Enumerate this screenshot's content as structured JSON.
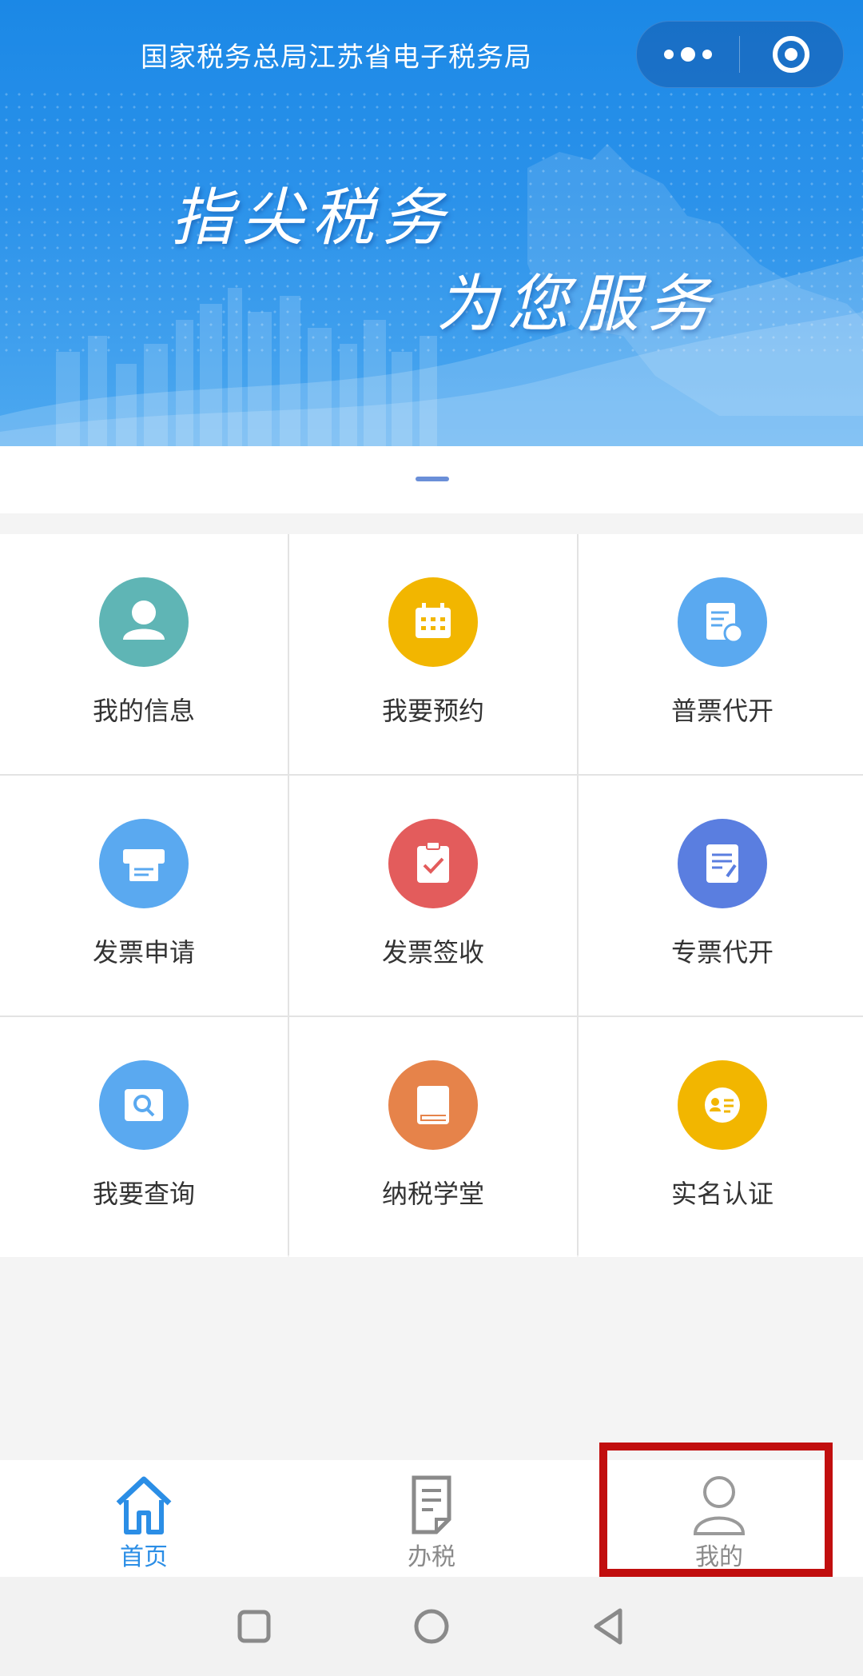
{
  "header": {
    "title": "国家税务总局江苏省电子税务局",
    "slogan_line1": "指尖税务",
    "slogan_line2": "为您服务"
  },
  "colors": {
    "header_blue": "#1b88e6",
    "accent_blue": "#2b8ee6",
    "highlight_red": "#c10e0e"
  },
  "grid": {
    "items": [
      {
        "label": "我的信息",
        "icon": "user-icon",
        "color": "#5fb5b5"
      },
      {
        "label": "我要预约",
        "icon": "calendar-icon",
        "color": "#f2b600"
      },
      {
        "label": "普票代开",
        "icon": "receipt-icon",
        "color": "#5aa9f0"
      },
      {
        "label": "发票申请",
        "icon": "printer-icon",
        "color": "#5aa9f0"
      },
      {
        "label": "发票签收",
        "icon": "clipboard-check-icon",
        "color": "#e35c5c"
      },
      {
        "label": "专票代开",
        "icon": "document-edit-icon",
        "color": "#5a7ee0"
      },
      {
        "label": "我要查询",
        "icon": "search-icon",
        "color": "#5aa9f0"
      },
      {
        "label": "纳税学堂",
        "icon": "book-icon",
        "color": "#e6834a"
      },
      {
        "label": "实名认证",
        "icon": "id-card-icon",
        "color": "#f2b600"
      }
    ]
  },
  "tabbar": {
    "items": [
      {
        "label": "首页",
        "icon": "home-icon",
        "active": true
      },
      {
        "label": "办税",
        "icon": "document-icon",
        "active": false
      },
      {
        "label": "我的",
        "icon": "person-icon",
        "active": false
      }
    ]
  }
}
